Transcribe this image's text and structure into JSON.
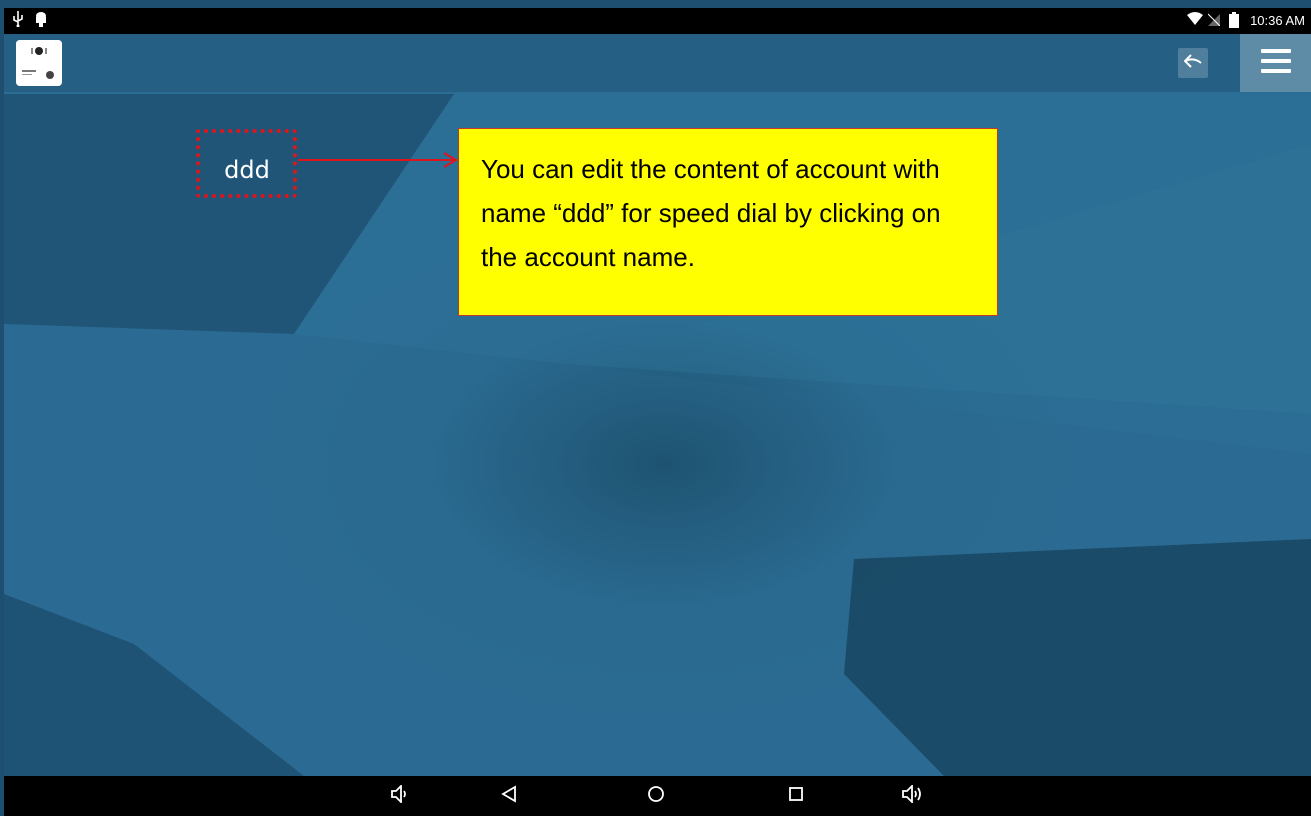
{
  "status_bar": {
    "time": "10:36 AM",
    "left_icons": [
      "usb-icon",
      "android-debug-icon"
    ],
    "right_icons": [
      "wifi-icon",
      "no-sim-icon",
      "battery-icon"
    ]
  },
  "top_bar": {
    "logo_icon": "app-logo-icon",
    "back_icon": "reply-icon",
    "menu_icon": "hamburger-menu-icon"
  },
  "account": {
    "name": "ddd"
  },
  "callout": {
    "text": "You can edit the content of account with name “ddd” for speed dial by clicking on the account name."
  },
  "nav_bar": {
    "icons": [
      "volume-down-icon",
      "back-triangle-icon",
      "home-circle-icon",
      "recents-square-icon",
      "volume-up-icon"
    ]
  },
  "colors": {
    "highlight": "#e0141b",
    "callout_background": "#ffff00",
    "wallpaper": "#2a6a90"
  }
}
